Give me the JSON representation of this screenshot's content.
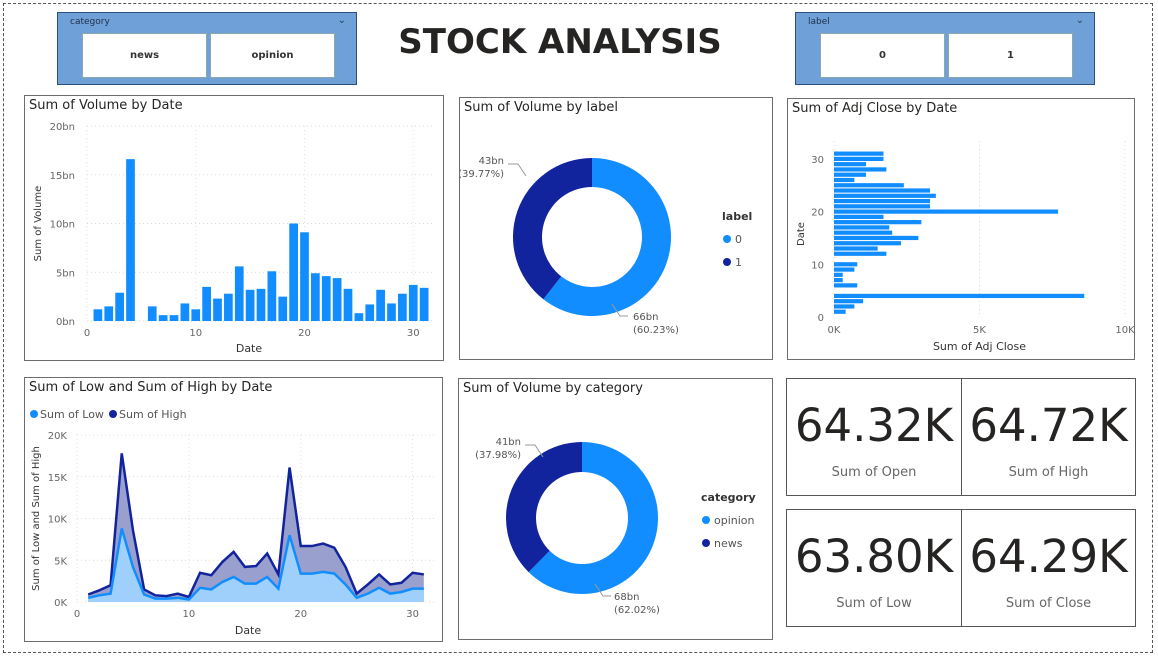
{
  "header": {
    "title": "STOCK ANALYSIS"
  },
  "slicers": {
    "category": {
      "title": "category",
      "options": [
        "news",
        "opinion"
      ]
    },
    "label": {
      "title": "label",
      "options": [
        "0",
        "1"
      ]
    }
  },
  "cards": [
    {
      "value": "64.32K",
      "label": "Sum of Open"
    },
    {
      "value": "64.72K",
      "label": "Sum of High"
    },
    {
      "value": "63.80K",
      "label": "Sum of Low"
    },
    {
      "value": "64.29K",
      "label": "Sum of Close"
    }
  ],
  "colors": {
    "light": "#118dff",
    "dark": "#12239e",
    "area_light": "#9fd0fb",
    "area_dark": "#8f96c8"
  },
  "chart_data": [
    {
      "id": "vol_date",
      "type": "bar",
      "title": "Sum of Volume by Date",
      "xlabel": "Date",
      "ylabel": "Sum of Volume",
      "xlim": [
        0,
        32
      ],
      "ylim": [
        0,
        20
      ],
      "xticks": [
        0,
        10,
        20,
        30
      ],
      "yticks": [
        0,
        5,
        10,
        15,
        20
      ],
      "yticklabels": [
        "0bn",
        "5bn",
        "10bn",
        "15bn",
        "20bn"
      ],
      "x": [
        1,
        2,
        3,
        4,
        5,
        6,
        7,
        8,
        9,
        10,
        11,
        12,
        13,
        14,
        15,
        16,
        17,
        18,
        19,
        20,
        21,
        22,
        23,
        24,
        25,
        26,
        27,
        28,
        29,
        30,
        31
      ],
      "values": [
        1.2,
        1.5,
        2.9,
        16.6,
        0,
        1.5,
        0.6,
        0.6,
        1.8,
        1.2,
        3.5,
        2.3,
        2.8,
        5.6,
        3.2,
        3.3,
        5.1,
        2.5,
        10.0,
        9.1,
        4.9,
        4.6,
        4.4,
        3.3,
        0.8,
        1.7,
        3.2,
        1.8,
        2.8,
        3.7,
        3.4
      ]
    },
    {
      "id": "vol_label",
      "type": "pie",
      "title": "Sum of Volume by label",
      "legend_title": "label",
      "legend_position": "right",
      "slices": [
        {
          "name": "0",
          "value": 66,
          "label": "66bn",
          "pct": "(60.23%)"
        },
        {
          "name": "1",
          "value": 43,
          "label": "43bn",
          "pct": "(39.77%)"
        }
      ]
    },
    {
      "id": "adj_date",
      "type": "bar",
      "orientation": "horizontal",
      "title": "Sum of Adj Close by Date",
      "xlabel": "Sum of Adj Close",
      "ylabel": "Date",
      "xlim": [
        0,
        10000
      ],
      "ylim": [
        0,
        31.5
      ],
      "xticks": [
        0,
        5000,
        10000
      ],
      "xticklabels": [
        "0K",
        "5K",
        "10K"
      ],
      "yticks": [
        0,
        10,
        20,
        30
      ],
      "y": [
        1,
        2,
        3,
        4,
        5,
        6,
        7,
        8,
        9,
        10,
        11,
        12,
        13,
        14,
        15,
        16,
        17,
        18,
        19,
        20,
        21,
        22,
        23,
        24,
        25,
        26,
        27,
        28,
        29,
        30,
        31
      ],
      "values": [
        400,
        700,
        1000,
        8600,
        0,
        800,
        300,
        300,
        700,
        800,
        0,
        1800,
        1500,
        2300,
        2900,
        2000,
        1900,
        3000,
        1700,
        7700,
        3300,
        3300,
        3500,
        3300,
        2400,
        700,
        1100,
        1800,
        1100,
        1700,
        1700
      ]
    },
    {
      "id": "low_high",
      "type": "area",
      "title": "Sum of Low and Sum of High by Date",
      "xlabel": "Date",
      "ylabel": "Sum of Low and Sum of High",
      "xlim": [
        0,
        32
      ],
      "ylim": [
        0,
        20000
      ],
      "xticks": [
        0,
        10,
        20,
        30
      ],
      "yticks": [
        0,
        5000,
        10000,
        15000,
        20000
      ],
      "yticklabels": [
        "0K",
        "5K",
        "10K",
        "15K",
        "20K"
      ],
      "legend_position": "top-left",
      "x": [
        1,
        2,
        3,
        4,
        5,
        6,
        7,
        8,
        9,
        10,
        11,
        12,
        13,
        14,
        15,
        16,
        17,
        18,
        19,
        20,
        21,
        22,
        23,
        24,
        25,
        26,
        27,
        28,
        29,
        30,
        31
      ],
      "series": [
        {
          "name": "Sum of Low",
          "values": [
            500,
            800,
            1000,
            8800,
            4200,
            900,
            400,
            400,
            500,
            300,
            1700,
            1500,
            2400,
            3000,
            2200,
            2200,
            3000,
            1600,
            8000,
            3400,
            3400,
            3600,
            3400,
            2100,
            500,
            1000,
            1700,
            1000,
            1200,
            1600,
            1600
          ]
        },
        {
          "name": "Sum of High",
          "values": [
            900,
            1400,
            2000,
            17800,
            8600,
            1500,
            800,
            700,
            1000,
            600,
            3500,
            3200,
            4800,
            6000,
            4200,
            4300,
            5800,
            3300,
            16100,
            6700,
            6700,
            7000,
            6500,
            4200,
            1000,
            2100,
            3300,
            2100,
            2300,
            3500,
            3300
          ]
        }
      ]
    },
    {
      "id": "vol_cat",
      "type": "pie",
      "title": "Sum of Volume by category",
      "legend_title": "category",
      "legend_position": "right",
      "slices": [
        {
          "name": "opinion",
          "value": 68,
          "label": "68bn",
          "pct": "(62.02%)"
        },
        {
          "name": "news",
          "value": 41,
          "label": "41bn",
          "pct": "(37.98%)"
        }
      ]
    }
  ]
}
